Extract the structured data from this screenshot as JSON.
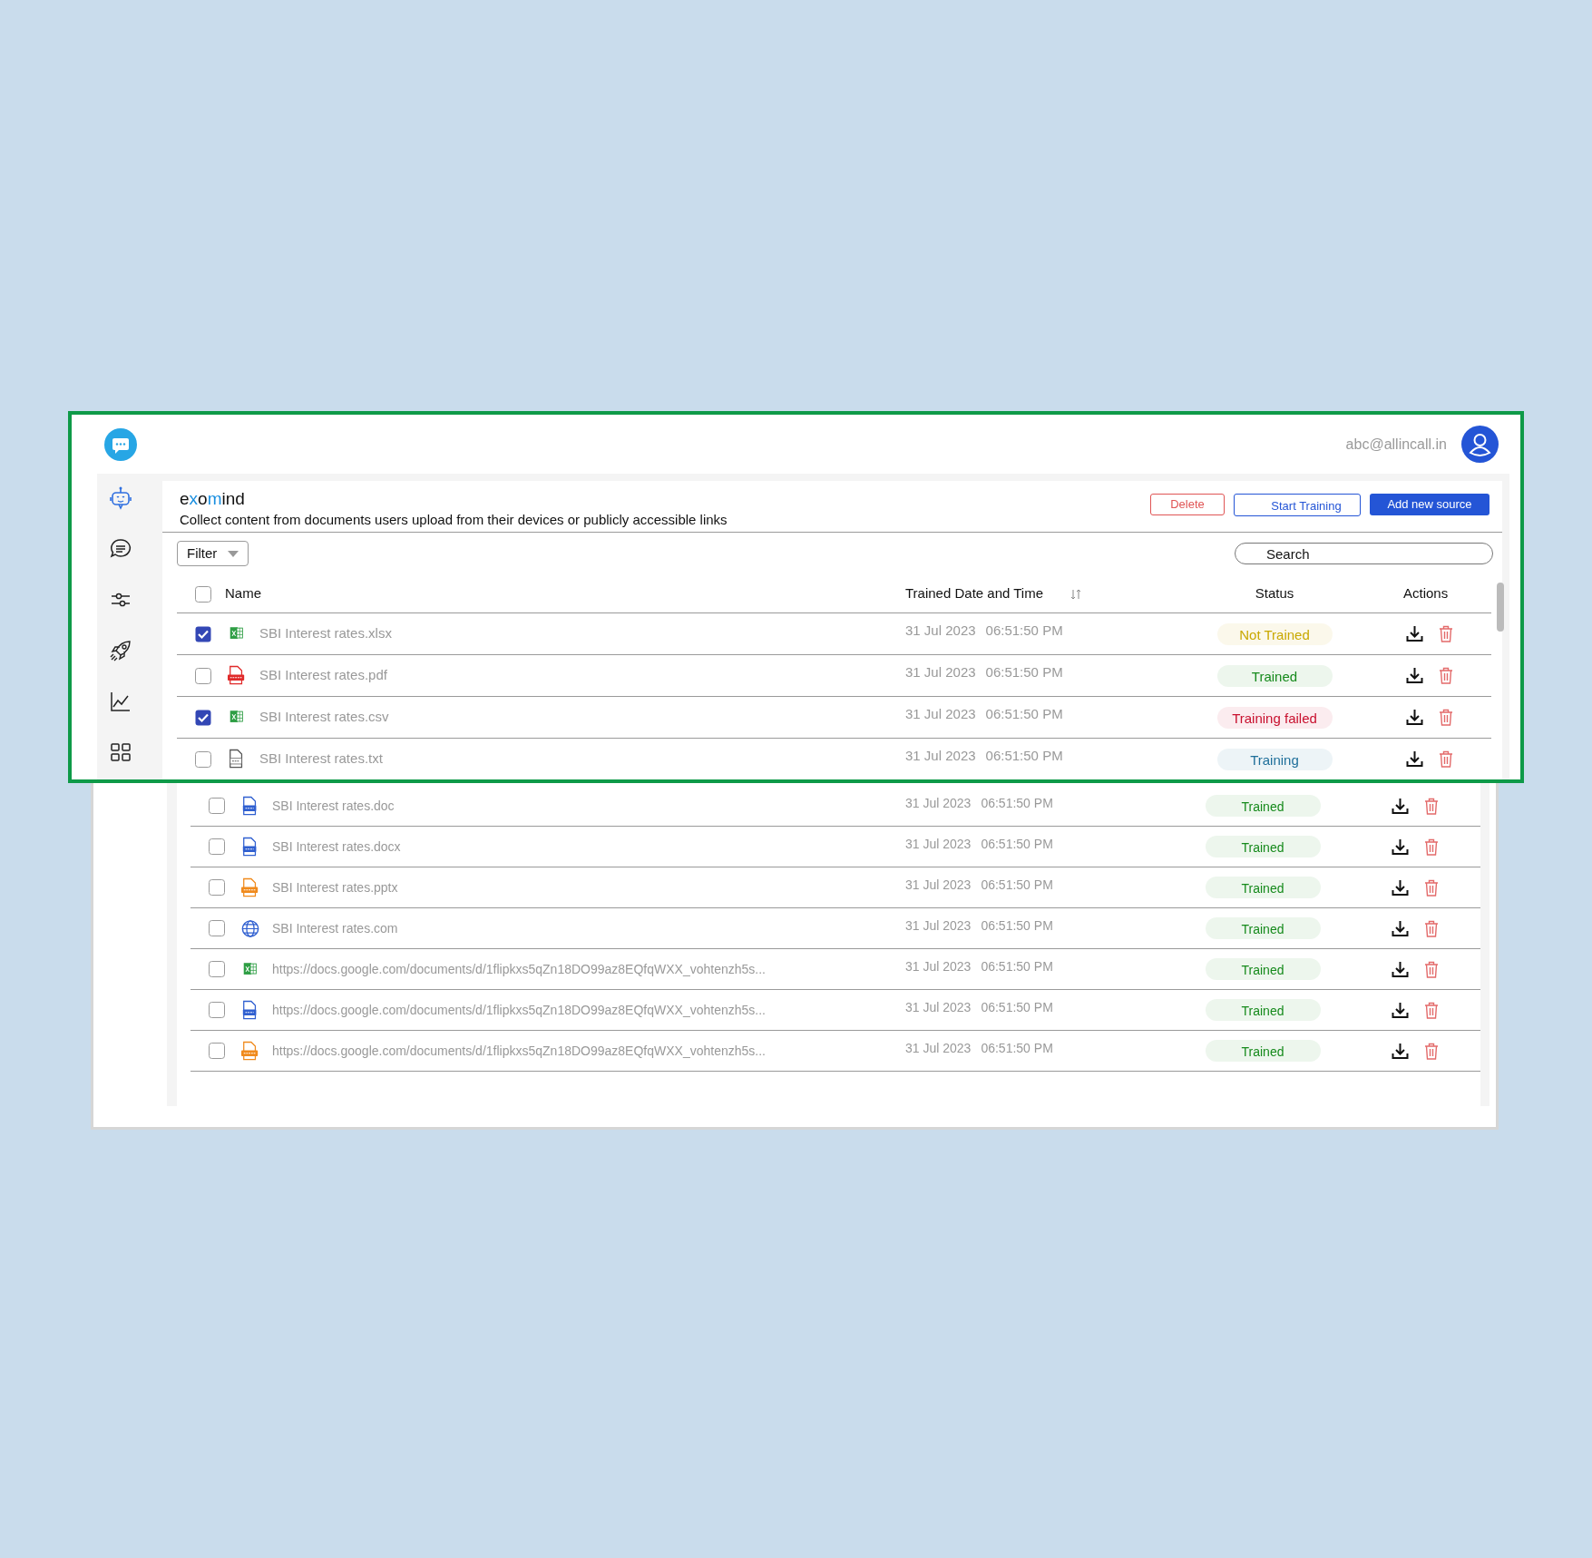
{
  "top_bar": {
    "user_email": "abc@allincall.in"
  },
  "sidebar": {
    "items": [
      {
        "selected": true
      },
      {
        "selected": false
      },
      {
        "selected": false
      },
      {
        "selected": false
      },
      {
        "selected": false
      },
      {
        "selected": false
      }
    ]
  },
  "page": {
    "title": "exomind",
    "subtitle": "Collect content from documents users upload from their devices or publicly accessible links",
    "buttons": [
      {
        "label": "Delete",
        "kind": "danger"
      },
      {
        "label": "Start Training",
        "kind": "outline"
      },
      {
        "label": "Add new source",
        "kind": "primary"
      }
    ],
    "filter": {
      "label": "Filter"
    },
    "search": {
      "placeholder": "Search"
    }
  },
  "table": {
    "select_all": {
      "checked": false
    },
    "columns": [
      "Name",
      "Trained Date and Time",
      "Status",
      "Actions"
    ],
    "rows": [
      {
        "name": "SBI Interest rates.xlsx",
        "icon": {
          "kind": "sheet"
        },
        "checked": true,
        "date": "31 Jul 2023",
        "time": "06:51:50 PM",
        "status": "Not Trained",
        "color": "#c9a800"
      },
      {
        "name": "SBI Interest rates.pdf",
        "icon": {
          "kind": "pdf"
        },
        "checked": false,
        "date": "31 Jul 2023",
        "time": "06:51:50 PM",
        "status": "Trained",
        "color": "#168a1c"
      },
      {
        "name": "SBI Interest rates.csv",
        "icon": {
          "kind": "sheet"
        },
        "checked": true,
        "date": "31 Jul 2023",
        "time": "06:51:50 PM",
        "status": "Training failed",
        "color": "#c8102e"
      },
      {
        "name": "SBI Interest rates.txt",
        "icon": {
          "kind": "txt"
        },
        "checked": false,
        "date": "31 Jul 2023",
        "time": "06:51:50 PM",
        "status": "Training",
        "color": "#1f6f9a"
      }
    ]
  },
  "lower_table": {
    "rows": [
      {
        "name": "SBI Interest rates.doc",
        "icon": {
          "kind": "doc"
        },
        "checked": false,
        "date": "31 Jul 2023",
        "time": "06:51:50 PM",
        "status": "Trained",
        "color": "#168a1c"
      },
      {
        "name": "SBI Interest rates.docx",
        "icon": {
          "kind": "doc"
        },
        "checked": false,
        "date": "31 Jul 2023",
        "time": "06:51:50 PM",
        "status": "Trained",
        "color": "#168a1c"
      },
      {
        "name": "SBI Interest rates.pptx",
        "icon": {
          "kind": "pptx"
        },
        "checked": false,
        "date": "31 Jul 2023",
        "time": "06:51:50 PM",
        "status": "Trained",
        "color": "#168a1c"
      },
      {
        "name": "SBI Interest rates.com",
        "icon": {
          "kind": "web"
        },
        "checked": false,
        "date": "31 Jul 2023",
        "time": "06:51:50 PM",
        "status": "Trained",
        "color": "#168a1c"
      },
      {
        "name": "https://docs.google.com/documents/d/1flipkxs5qZn18DO99az8EQfqWXX_vohtenzh5s...",
        "icon": {
          "kind": "sheet"
        },
        "checked": false,
        "date": "31 Jul 2023",
        "time": "06:51:50 PM",
        "status": "Trained",
        "color": "#168a1c"
      },
      {
        "name": "https://docs.google.com/documents/d/1flipkxs5qZn18DO99az8EQfqWXX_vohtenzh5s...",
        "icon": {
          "kind": "doc"
        },
        "checked": false,
        "date": "31 Jul 2023",
        "time": "06:51:50 PM",
        "status": "Trained",
        "color": "#168a1c"
      },
      {
        "name": "https://docs.google.com/documents/d/1flipkxs5qZn18DO99az8EQfqWXX_vohtenzh5s...",
        "icon": {
          "kind": "pptx"
        },
        "checked": false,
        "date": "31 Jul 2023",
        "time": "06:51:50 PM",
        "status": "Trained",
        "color": "#168a1c"
      }
    ]
  }
}
